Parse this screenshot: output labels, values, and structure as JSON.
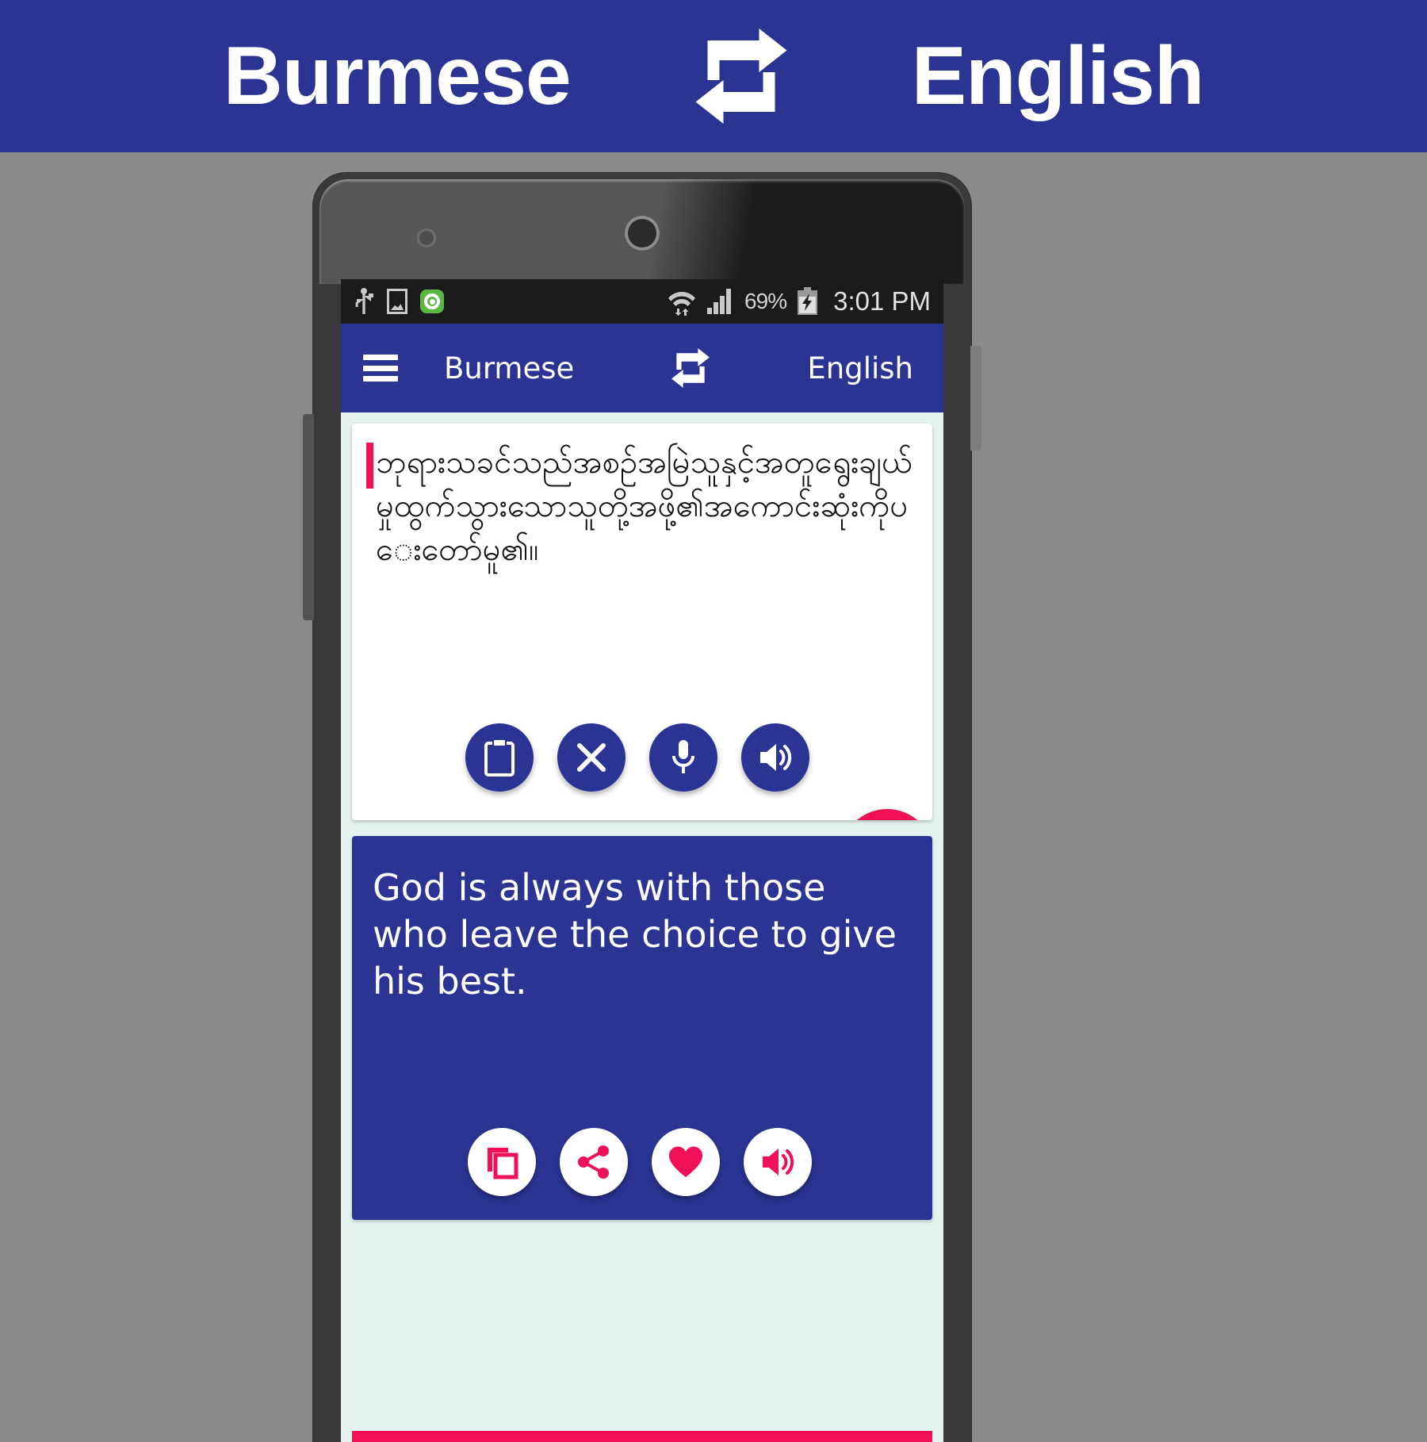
{
  "banner": {
    "source_language": "Burmese",
    "target_language": "English",
    "swap_icon": "swap-arrows-icon",
    "background_color": "#2b3493",
    "text_color": "#ffffff"
  },
  "statusbar": {
    "left_icons": [
      "usb-icon",
      "gallery-icon",
      "app-green-icon"
    ],
    "wifi_icon": "wifi-data-icon",
    "signal_icon": "cellular-signal-icon",
    "battery_percent": "69%",
    "battery_icon": "battery-charging-icon",
    "time": "3:01 PM",
    "background_color": "#1b1b1b"
  },
  "toolbar": {
    "menu_icon": "hamburger-menu-icon",
    "source_language": "Burmese",
    "swap_icon": "swap-arrows-icon",
    "target_language": "English",
    "background_color": "#2b3493"
  },
  "input_card": {
    "text": "ဘုရားသခင်သည်အစဉ်အမြဲသူနှင့်အတူရွေးချယ်မှုထွက်သွားသောသူတို့အဖို့၏အကောင်းဆုံးကိုပေးတော်မူ၏။",
    "caret_color": "#ef1055",
    "actions": [
      {
        "name": "paste-button",
        "icon": "clipboard-icon"
      },
      {
        "name": "clear-button",
        "icon": "close-x-icon"
      },
      {
        "name": "voice-input-button",
        "icon": "microphone-icon"
      },
      {
        "name": "speak-source-button",
        "icon": "speaker-icon"
      }
    ]
  },
  "send_button": {
    "icon": "send-paper-plane-icon",
    "color": "#ef1055"
  },
  "output_card": {
    "text": "God is always with those who leave the choice to give his best.",
    "background_color": "#2b3493",
    "actions": [
      {
        "name": "copy-button",
        "icon": "copy-icon"
      },
      {
        "name": "share-button",
        "icon": "share-icon"
      },
      {
        "name": "favorite-button",
        "icon": "heart-icon"
      },
      {
        "name": "speak-result-button",
        "icon": "speaker-icon"
      }
    ]
  },
  "accent_color": "#ef1055",
  "primary_color": "#2b3493"
}
